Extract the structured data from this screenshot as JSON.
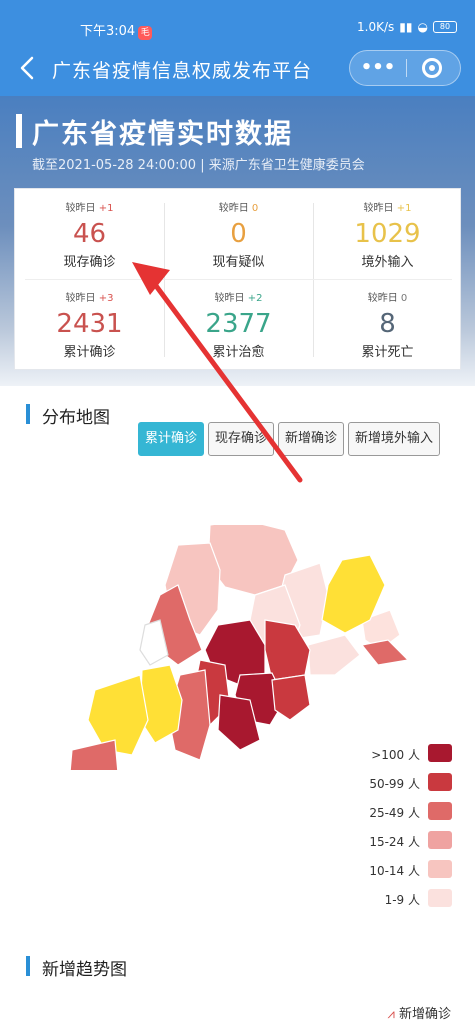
{
  "statusbar": {
    "time": "下午3:04",
    "notif_badge": "毛",
    "net": "1.0K/s",
    "battery": "80"
  },
  "navbar": {
    "title": "广东省疫情信息权威发布平台",
    "more_label": "•••"
  },
  "hero": {
    "title": "广东省疫情实时数据",
    "subtitle": "截至2021-05-28 24:00:00 | 来源广东省卫生健康委员会"
  },
  "stats": [
    {
      "cmp_label": "较昨日",
      "delta": "+1",
      "value": "46",
      "label": "现存确诊",
      "color": "#c9524f",
      "delta_color": "#d9534f"
    },
    {
      "cmp_label": "较昨日",
      "delta": "0",
      "value": "0",
      "label": "现有疑似",
      "color": "#e8a040",
      "delta_color": "#e8a040"
    },
    {
      "cmp_label": "较昨日",
      "delta": "+1",
      "value": "1029",
      "label": "境外输入",
      "color": "#e8c24a",
      "delta_color": "#e8c24a"
    },
    {
      "cmp_label": "较昨日",
      "delta": "+3",
      "value": "2431",
      "label": "累计确诊",
      "color": "#c9524f",
      "delta_color": "#d9534f"
    },
    {
      "cmp_label": "较昨日",
      "delta": "+2",
      "value": "2377",
      "label": "累计治愈",
      "color": "#3aa58a",
      "delta_color": "#3aa58a"
    },
    {
      "cmp_label": "较昨日",
      "delta": "0",
      "value": "8",
      "label": "累计死亡",
      "color": "#556677",
      "delta_color": "#777777"
    }
  ],
  "map_section": {
    "title": "分布地图",
    "tabs": [
      "累计确诊",
      "现存确诊",
      "新增确诊",
      "新增境外输入"
    ],
    "active_tab": "累计确诊"
  },
  "legend": [
    {
      "label": ">100 人",
      "color": "#a8182f"
    },
    {
      "label": "50-99 人",
      "color": "#c9393f"
    },
    {
      "label": "25-49 人",
      "color": "#df6a68"
    },
    {
      "label": "15-24 人",
      "color": "#efa3a1"
    },
    {
      "label": "10-14 人",
      "color": "#f7c5c0"
    },
    {
      "label": "1-9 人",
      "color": "#fbe1de"
    }
  ],
  "trend_section": {
    "title": "新增趋势图",
    "legend_label": "新增确诊"
  },
  "colors": {
    "accent": "#3d8fe0",
    "tab_active": "#35b6d4",
    "arrow": "#e53333"
  }
}
